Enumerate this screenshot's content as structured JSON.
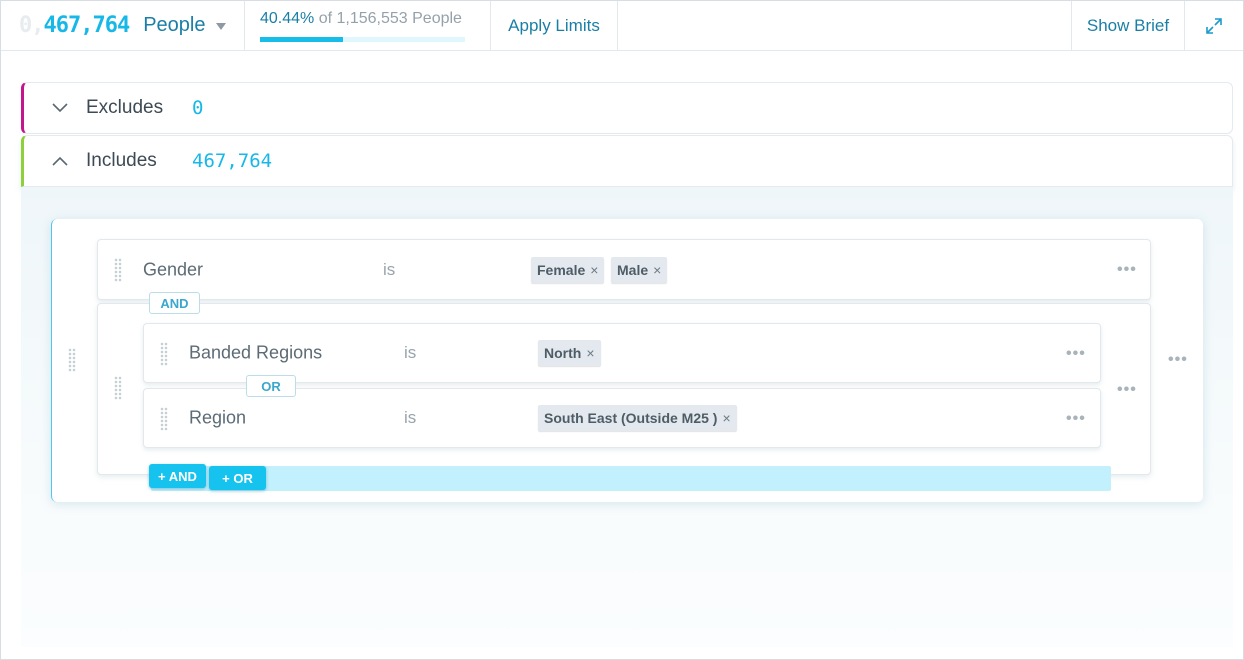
{
  "header": {
    "count_ghost": "0,",
    "count": "467,764",
    "count_unit": "People",
    "percent": "40.44%",
    "percent_rest": "of 1,156,553 People",
    "percent_fill": 0.4044,
    "apply_limits": "Apply Limits",
    "show_brief": "Show Brief"
  },
  "excludes": {
    "label": "Excludes",
    "count": "0",
    "color": "#c4158f"
  },
  "includes": {
    "label": "Includes",
    "count": "467,764",
    "color": "#8fd03a"
  },
  "conditions": [
    {
      "field": "Gender",
      "operator": "is",
      "values": [
        "Female",
        "Male"
      ]
    },
    {
      "field": "Banded Regions",
      "operator": "is",
      "values": [
        "North"
      ]
    },
    {
      "field": "Region",
      "operator": "is",
      "values": [
        "South East (Outside M25 )"
      ]
    }
  ],
  "connectors": {
    "and": "AND",
    "or": "OR"
  },
  "add_buttons": {
    "and": "+ AND",
    "or": "+ OR"
  },
  "icons": {
    "caret": "caret-down-icon",
    "expand": "expand-icon",
    "collapse": "chevron-down-icon",
    "expanded": "chevron-up-icon",
    "drag": "drag-handle-icon",
    "more": "more-horizontal-icon",
    "remove": "remove-x-icon"
  },
  "accent_color": "#17b8e8"
}
